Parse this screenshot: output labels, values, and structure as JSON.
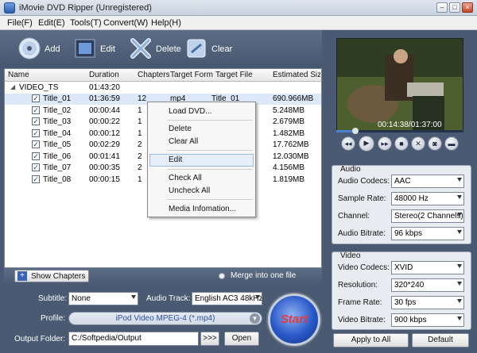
{
  "window": {
    "title": "iMovie DVD Ripper (Unregistered)"
  },
  "menu": [
    "File(F)",
    "Edit(E)",
    "Tools(T)",
    "Convert(W)",
    "Help(H)"
  ],
  "toolbar": {
    "add": "Add",
    "edit": "Edit",
    "delete": "Delete",
    "clear": "Clear"
  },
  "list": {
    "headers": {
      "name": "Name",
      "duration": "Duration",
      "chapters": "Chapters",
      "format": "Target Format",
      "file": "Target File",
      "size": "Estimated Size"
    },
    "root": {
      "name": "VIDEO_TS",
      "duration": "01:43:20"
    },
    "rows": [
      {
        "name": "Title_01",
        "duration": "01:36:59",
        "chapters": "12",
        "format": "mp4",
        "file": "Title_01",
        "size": "690.966MB"
      },
      {
        "name": "Title_02",
        "duration": "00:00:44",
        "chapters": "1",
        "format": "",
        "file": "",
        "size": "5.248MB"
      },
      {
        "name": "Title_03",
        "duration": "00:00:22",
        "chapters": "1",
        "format": "",
        "file": "",
        "size": "2.679MB"
      },
      {
        "name": "Title_04",
        "duration": "00:00:12",
        "chapters": "1",
        "format": "",
        "file": "",
        "size": "1.482MB"
      },
      {
        "name": "Title_05",
        "duration": "00:02:29",
        "chapters": "2",
        "format": "",
        "file": "",
        "size": "17.762MB"
      },
      {
        "name": "Title_06",
        "duration": "00:01:41",
        "chapters": "2",
        "format": "",
        "file": "",
        "size": "12.030MB"
      },
      {
        "name": "Title_07",
        "duration": "00:00:35",
        "chapters": "2",
        "format": "",
        "file": "",
        "size": "4.156MB"
      },
      {
        "name": "Title_08",
        "duration": "00:00:15",
        "chapters": "1",
        "format": "",
        "file": "",
        "size": "1.819MB"
      }
    ]
  },
  "context_menu": {
    "load": "Load DVD...",
    "delete": "Delete",
    "clear_all": "Clear All",
    "edit": "Edit",
    "check_all": "Check All",
    "uncheck_all": "Uncheck All",
    "media_info": "Media Infomation..."
  },
  "chapters_button": "Show Chapters",
  "merge_label": "Merge into one file",
  "output": {
    "subtitle_label": "Subtitle:",
    "subtitle_value": "None",
    "audio_track_label": "Audio Track:",
    "audio_track_value": "English AC3 48kHz",
    "profile_label": "Profile:",
    "profile_value": "iPod Video MPEG-4 (*.mp4)",
    "folder_label": "Output Folder:",
    "folder_value": "C:/Softpedia/Output",
    "browse_label": ">>>",
    "open_label": "Open",
    "start_label": "Start"
  },
  "player": {
    "time": "00:14:38/01:37:00",
    "progress_fraction": 0.151
  },
  "audio": {
    "title": "Audio",
    "codec_label": "Audio Codecs:",
    "codec_value": "AAC",
    "rate_label": "Sample Rate:",
    "rate_value": "48000 Hz",
    "channel_label": "Channel:",
    "channel_value": "Stereo(2 Channels)",
    "bitrate_label": "Audio Bitrate:",
    "bitrate_value": "96 kbps"
  },
  "video": {
    "title": "Video",
    "codec_label": "Video Codecs:",
    "codec_value": "XVID",
    "res_label": "Resolution:",
    "res_value": "320*240",
    "fps_label": "Frame Rate:",
    "fps_value": "30 fps",
    "bitrate_label": "Video Bitrate:",
    "bitrate_value": "900 kbps"
  },
  "apply_label": "Apply to All",
  "default_label": "Default",
  "colors": {
    "panel": "#4a5a72",
    "accent": "#4a7fd6",
    "start": "#2858c8"
  }
}
